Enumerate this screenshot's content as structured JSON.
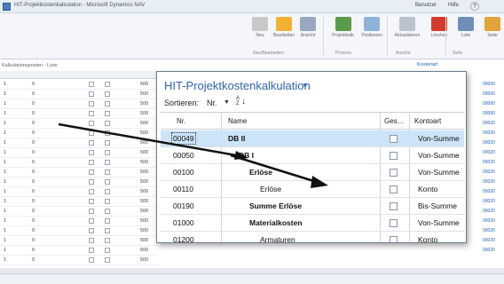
{
  "titlebar": {
    "title": "HIT-Projektkostenkalkulation - Microsoft Dynamics NAV",
    "user": "Benutzer",
    "help": "Hilfe",
    "help_icon": "question-icon"
  },
  "ribbon": {
    "buttons": [
      {
        "label": "Neu",
        "icon": "new-icon",
        "color": "#c8c8c8"
      },
      {
        "label": "Bearbeiten",
        "icon": "edit-icon",
        "color": "#f2b134"
      },
      {
        "label": "Ansicht",
        "icon": "view-icon",
        "color": "#9aa7c2"
      },
      {
        "label": "Projektkalk.",
        "icon": "project-icon",
        "color": "#5b9a4a"
      },
      {
        "label": "Positionen",
        "icon": "lines-icon",
        "color": "#8fb2d9"
      },
      {
        "label": "Aktualisieren",
        "icon": "refresh-icon",
        "color": "#b9c2cf"
      },
      {
        "label": "Löschen",
        "icon": "delete-icon",
        "color": "#d23b2f"
      },
      {
        "label": "Liste",
        "icon": "list-icon",
        "color": "#6f8fb8"
      },
      {
        "label": "Seite",
        "icon": "page-icon",
        "color": "#e0a43a"
      }
    ],
    "groups": [
      "Neu/Bearbeiten",
      "Prozess",
      "Ansicht",
      "Seite"
    ]
  },
  "subheader": {
    "left": "Kalkulationsposten - Liste",
    "right": "Kostenart"
  },
  "left_list": {
    "rows": [
      {
        "c1": "1",
        "c2": "0",
        "c3": "500"
      },
      {
        "c1": "1",
        "c2": "0",
        "c3": "500"
      },
      {
        "c1": "1",
        "c2": "0",
        "c3": "500"
      },
      {
        "c1": "1",
        "c2": "0",
        "c3": "500"
      },
      {
        "c1": "1",
        "c2": "0",
        "c3": "500"
      },
      {
        "c1": "1",
        "c2": "0",
        "c3": "500"
      },
      {
        "c1": "1",
        "c2": "0",
        "c3": "500"
      },
      {
        "c1": "1",
        "c2": "0",
        "c3": "500"
      },
      {
        "c1": "1",
        "c2": "0",
        "c3": "500"
      },
      {
        "c1": "1",
        "c2": "0",
        "c3": "500"
      },
      {
        "c1": "1",
        "c2": "0",
        "c3": "500"
      },
      {
        "c1": "1",
        "c2": "0",
        "c3": "500"
      },
      {
        "c1": "1",
        "c2": "0",
        "c3": "500"
      },
      {
        "c1": "1",
        "c2": "0",
        "c3": "500"
      },
      {
        "c1": "1",
        "c2": "0",
        "c3": "500"
      },
      {
        "c1": "1",
        "c2": "0",
        "c3": "500"
      },
      {
        "c1": "1",
        "c2": "0",
        "c3": "500"
      },
      {
        "c1": "1",
        "c2": "0",
        "c3": "500"
      },
      {
        "c1": "1",
        "c2": "0",
        "c3": "500"
      }
    ]
  },
  "right_list": {
    "rows": [
      {
        "a": "80",
        "b": "00000"
      },
      {
        "a": "",
        "b": "00000"
      },
      {
        "a": "",
        "b": "00000"
      },
      {
        "a": "",
        "b": "00000"
      },
      {
        "a": "",
        "b": "00020"
      },
      {
        "a": "",
        "b": "00020"
      },
      {
        "a": "",
        "b": "00020"
      },
      {
        "a": "",
        "b": "00020"
      },
      {
        "a": "",
        "b": "00020"
      },
      {
        "a": "",
        "b": "00020"
      },
      {
        "a": "",
        "b": "00020"
      },
      {
        "a": "",
        "b": "00020"
      },
      {
        "a": "",
        "b": "00020"
      },
      {
        "a": "",
        "b": "00020"
      },
      {
        "a": "",
        "b": "00020"
      },
      {
        "a": "",
        "b": "00020"
      },
      {
        "a": "",
        "b": "00020"
      },
      {
        "a": "",
        "b": "00020"
      }
    ]
  },
  "dialog": {
    "title": "HIT-Projektkostenkalkulation",
    "sort_label": "Sortieren:",
    "sort_value": "Nr.",
    "sort_icon": "sort-ascending-icon",
    "columns": {
      "nr": "Nr.",
      "name": "Name",
      "ges": "Ges...",
      "kontoart": "Kontoart"
    },
    "rows": [
      {
        "nr": "00049",
        "name": "DB II",
        "bold": true,
        "indent": 0,
        "kontoart": "Von-Summe",
        "selected": true
      },
      {
        "nr": "00050",
        "name": "DB I",
        "bold": true,
        "indent": 1,
        "kontoart": "Von-Summe",
        "selected": false
      },
      {
        "nr": "00100",
        "name": "Erlöse",
        "bold": true,
        "indent": 2,
        "kontoart": "Von-Summe",
        "selected": false
      },
      {
        "nr": "00110",
        "name": "Erlöse",
        "bold": false,
        "indent": 3,
        "kontoart": "Konto",
        "selected": false
      },
      {
        "nr": "00190",
        "name": "Summe Erlöse",
        "bold": true,
        "indent": 2,
        "kontoart": "Bis-Summe",
        "selected": false
      },
      {
        "nr": "01000",
        "name": "Materialkosten",
        "bold": true,
        "indent": 2,
        "kontoart": "Von-Summe",
        "selected": false
      },
      {
        "nr": "01200",
        "name": "Armaturen",
        "bold": false,
        "indent": 3,
        "kontoart": "Konto",
        "selected": false
      }
    ]
  }
}
